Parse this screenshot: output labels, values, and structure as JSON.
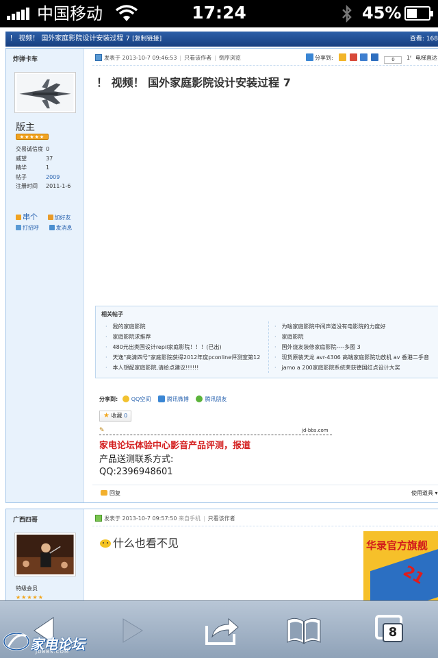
{
  "status_bar": {
    "carrier": "中国移动",
    "time": "17:24",
    "battery": "45%"
  },
  "thread": {
    "header_title": "！ 视频！ 国外家庭影院设计安装过程 7",
    "copy_link": "[复制链接]",
    "views_label": "查看: 168"
  },
  "post1": {
    "username": "炸弹卡车",
    "rank": "版主",
    "stats": [
      {
        "label": "交易诚信度",
        "value": "0"
      },
      {
        "label": "威望",
        "value": "37"
      },
      {
        "label": "精华",
        "value": "1"
      },
      {
        "label": "帖子",
        "value": "2009"
      },
      {
        "label": "注册时间",
        "value": "2011-1-6"
      }
    ],
    "links": {
      "home": "串个",
      "add_friend": "加好友",
      "greet": "打招呼",
      "message": "发消息"
    },
    "posted_at": "发表于 2013-10-7 09:46:53",
    "author_only": "只看该作者",
    "reverse": "倒序浏览",
    "share_to": "分享到:",
    "share_count": "0",
    "ladder": "电梯直达",
    "title": "！ 视频！ 国外家庭影院设计安装过程 7",
    "related_header": "相关帖子",
    "related_left": [
      "我的家庭影院",
      "家庭影院求推荐",
      "480元出类国设计repil家庭影院！！！(已出)",
      "天逸\"高清四号\"家庭影院获得2012年度pconline评测室第12",
      "本人想配家庭影院,请给点建议!!!!!!"
    ],
    "related_right": [
      "为啥家庭影院中间声道没有电影院的力度好",
      "家庭影院",
      "国外烧友装修家庭影院----多图 3",
      "现货原装天龙 avr-4306 高端家庭影院功放机 av 香港二手音",
      "jamo a 200家庭影院系统荣获德国红点设计大奖"
    ],
    "share_label": "分享到:",
    "share_qzone": "QQ空间",
    "share_weibo": "腾讯微博",
    "share_friends": "腾讯朋友",
    "fav_label": "收藏",
    "fav_count": "0",
    "sig_source": "jd-bbs.com",
    "sig_line1": "家电论坛体验中心影音产品评测，报道",
    "sig_line2": "产品送测联系方式:",
    "sig_line3": "QQ:2396948601",
    "reply": "回复",
    "tools": "使用道具 ▾"
  },
  "post2": {
    "username": "广西四哥",
    "rank": "特级会员",
    "stars": "★★★★★",
    "posted_at": "发表于 2013-10-7 09:57:50",
    "from_mobile": "来自手机",
    "author_only": "只看该作者",
    "body": "什么也看不见",
    "ad_text": "华录官方旗舰",
    "ad_number": "21"
  },
  "toolbar": {
    "tabs_count": "8"
  },
  "watermark": {
    "text": "家电论坛",
    "sub": "JDBBS.COM"
  },
  "colors": {
    "header_blue": "#2d5fa8",
    "sidebar_bg": "#e8f2fc",
    "signature_red": "#d42020",
    "link_blue": "#2a64b0"
  }
}
